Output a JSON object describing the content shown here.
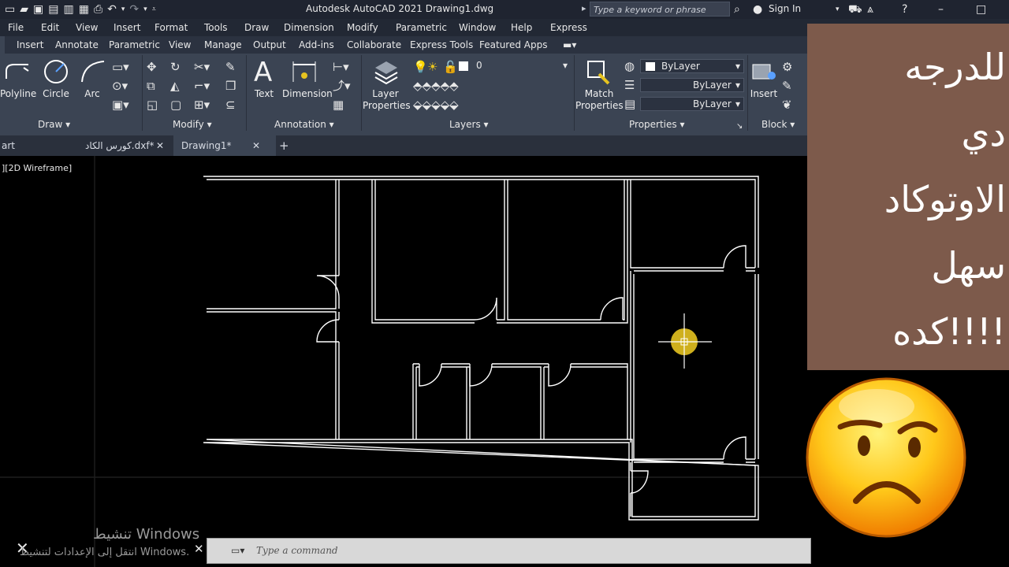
{
  "titlebar": {
    "title": "Autodesk AutoCAD 2021   Drawing1.dwg",
    "search_placeholder": "Type a keyword or phrase",
    "sign_in": "Sign In"
  },
  "menu": [
    "File",
    "Edit",
    "View",
    "Insert",
    "Format",
    "Tools",
    "Draw",
    "Dimension",
    "Modify",
    "Parametric",
    "Window",
    "Help",
    "Express"
  ],
  "ribbon_tabs": [
    "Insert",
    "Annotate",
    "Parametric",
    "View",
    "Manage",
    "Output",
    "Add-ins",
    "Collaborate",
    "Express Tools",
    "Featured Apps"
  ],
  "draw_panel": {
    "polyline": "Polyline",
    "circle": "Circle",
    "arc": "Arc",
    "label": "Draw"
  },
  "modify_panel": {
    "label": "Modify"
  },
  "annotation_panel": {
    "text": "Text",
    "dimension": "Dimension",
    "label": "Annotation"
  },
  "layers_panel": {
    "layer_properties_1": "Layer",
    "layer_properties_2": "Properties",
    "current_layer": "0",
    "label": "Layers"
  },
  "properties_panel": {
    "match_1": "Match",
    "match_2": "Properties",
    "color": "ByLayer",
    "linetype": "ByLayer",
    "lineweight": "ByLayer",
    "label": "Properties"
  },
  "block_panel": {
    "insert": "Insert",
    "label": "Block"
  },
  "doc_tabs": [
    {
      "label": "art"
    },
    {
      "label": "كورس الكاد.dxf*"
    },
    {
      "label": "Drawing1*"
    }
  ],
  "viewport_label": "][2D Wireframe]",
  "command": {
    "placeholder": "Type a command"
  },
  "watermark": {
    "line1": "تنشيط Windows",
    "line2": "انتقل إلى الإعدادات لتنشيط Windows."
  },
  "overlay": {
    "lines": [
      "للدرجه",
      "دي",
      "الاوتوكاد",
      "سهل",
      "كده!!!!"
    ],
    "bg_color": "#7d5a4b"
  },
  "colors": {
    "accent": "#e6c320",
    "ribbon": "#3b4453",
    "plan_lines": "#ffffff"
  }
}
